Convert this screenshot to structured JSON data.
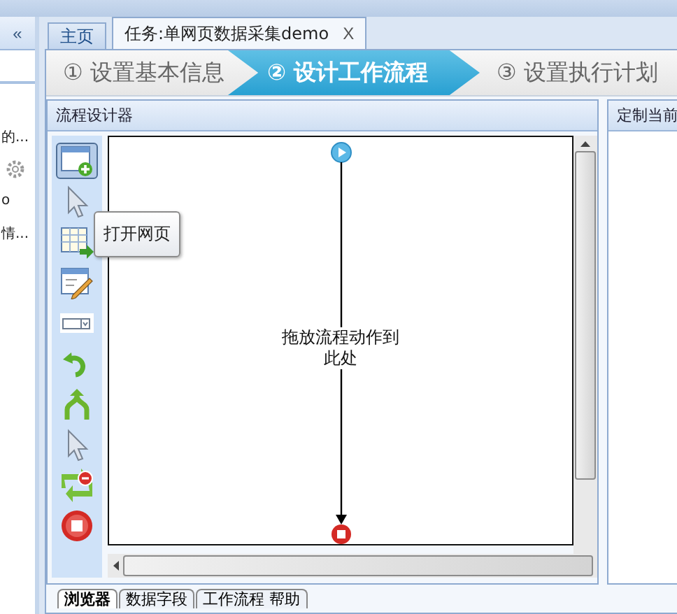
{
  "sidebar": {
    "collapse_glyph": "«",
    "items": [
      {
        "kind": "text",
        "label": "的..."
      },
      {
        "kind": "gear"
      },
      {
        "kind": "text",
        "label": "o"
      },
      {
        "kind": "text",
        "label": "情..."
      }
    ]
  },
  "tabs": [
    {
      "label": "主页",
      "selected": false
    },
    {
      "label": "任务:单网页数据采集demo",
      "selected": true,
      "close_glyph": "X"
    }
  ],
  "steps": [
    {
      "number": "①",
      "label": "设置基本信息",
      "selected": false
    },
    {
      "number": "②",
      "label": "设计工作流程",
      "selected": true
    },
    {
      "number": "③",
      "label": "设置执行计划",
      "selected": false
    }
  ],
  "designer": {
    "title": "流程设计器",
    "tooltip": "打开网页",
    "hint": "拖放流程动作到此处",
    "tools": [
      {
        "kind": "window-add",
        "selected": true
      },
      {
        "kind": "pointer",
        "selected": false
      },
      {
        "kind": "table-arrow",
        "selected": false
      },
      {
        "kind": "form-edit",
        "selected": false
      },
      {
        "kind": "dropdown",
        "selected": false
      },
      {
        "kind": "loop",
        "selected": false
      },
      {
        "kind": "branch",
        "selected": false
      },
      {
        "kind": "pointer",
        "selected": false
      },
      {
        "kind": "loop-stop",
        "selected": false
      },
      {
        "kind": "stop",
        "selected": false
      }
    ]
  },
  "side_panel": {
    "title": "定制当前"
  },
  "bottom_tabs": [
    {
      "label": "浏览器",
      "selected": true
    },
    {
      "label": "数据字段",
      "selected": false
    },
    {
      "label": "工作流程 帮助",
      "selected": false
    }
  ]
}
